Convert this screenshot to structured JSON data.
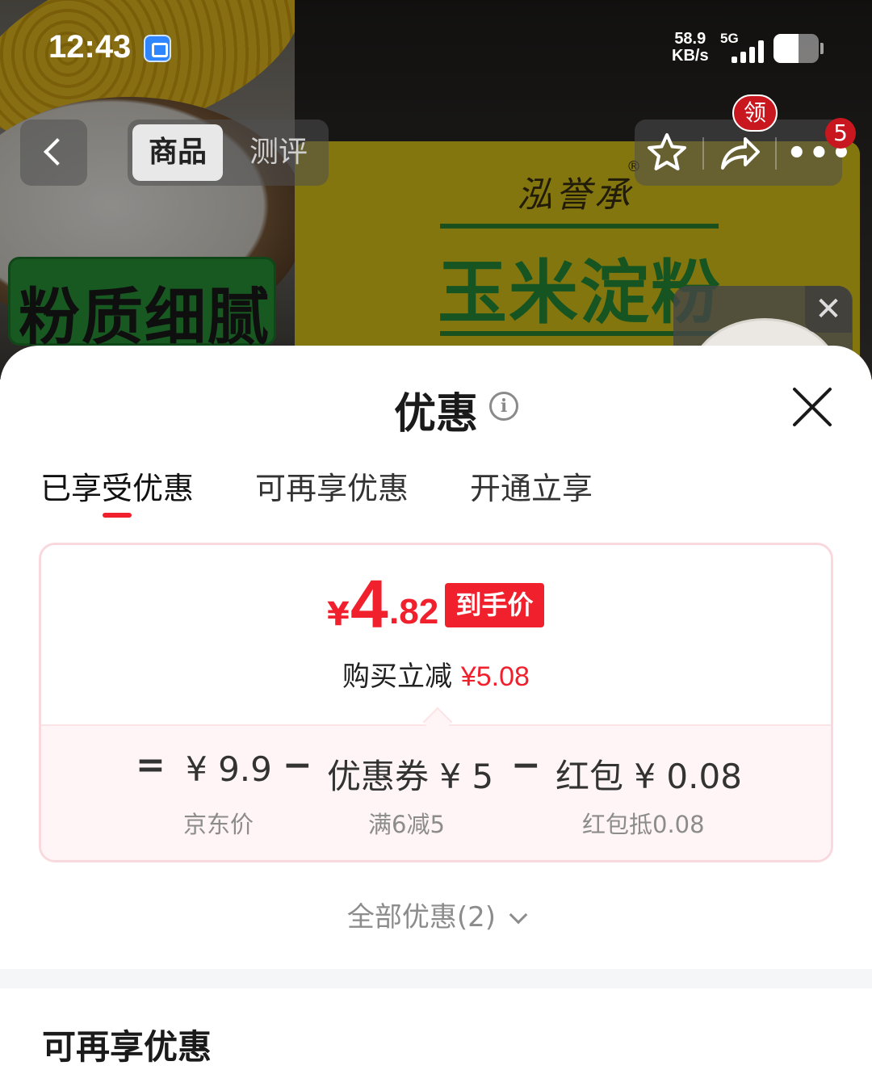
{
  "status_bar": {
    "time": "12:43",
    "net_speed_value": "58.9",
    "net_speed_unit": "KB/s",
    "network_type": "5G",
    "battery_level": 0.55
  },
  "product_image": {
    "brand_script": "泓誉承",
    "brand_reg_mark": "®",
    "bag_title": "玉米淀粉",
    "badge_text": "粉质细腻"
  },
  "nav": {
    "tabs": [
      "商品",
      "测评"
    ],
    "active_tab": "商品",
    "coupon_badge": "领",
    "message_count": "5"
  },
  "mini_player": {
    "close_glyph": "✕"
  },
  "sheet": {
    "title": "优惠",
    "info_glyph": "i",
    "tabs": [
      "已享受优惠",
      "可再享优惠",
      "开通立享"
    ],
    "active_tab_index": 0,
    "price": {
      "currency": "¥",
      "integer": "4",
      "decimal": ".82",
      "tag": "到手价"
    },
    "saving": {
      "label": "购买立减",
      "amount": "¥5.08"
    },
    "breakdown": {
      "equals": "=",
      "minus": "−",
      "items": [
        {
          "value": "¥ 9.9",
          "sub": "京东价"
        },
        {
          "value": "优惠券 ¥ 5",
          "sub": "满6减5"
        },
        {
          "value": "红包 ¥ 0.08",
          "sub": "红包抵0.08"
        }
      ]
    },
    "all_offers": "全部优惠(2)",
    "section_title": "可再享优惠"
  },
  "colors": {
    "accent_red": "#f0202d",
    "badge_red": "#c8171f",
    "card_border": "#f9d9de",
    "card_bottom_bg": "#fff5f6",
    "muted_text": "#8c8c8c"
  }
}
